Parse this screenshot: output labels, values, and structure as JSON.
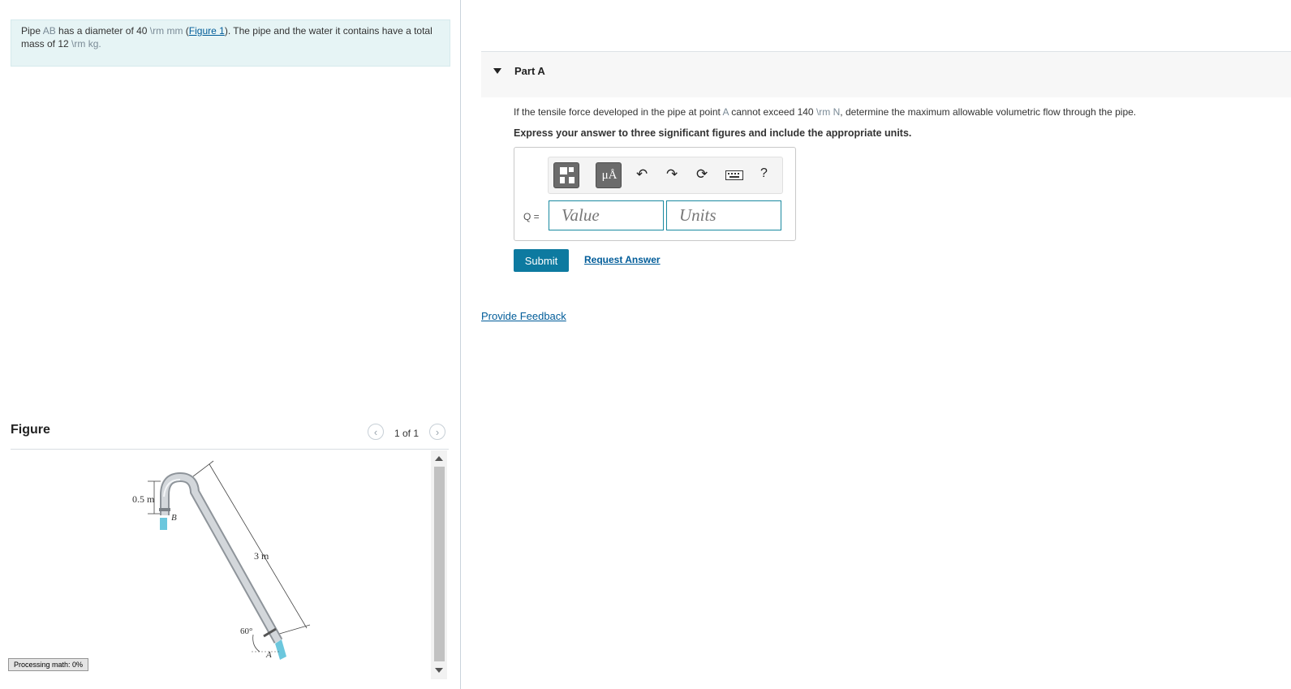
{
  "problem": {
    "pipe_text_1": "Pipe ",
    "pipe_label": "AB",
    "pipe_text_2": " has a diameter of 40 ",
    "diameter_unit": "\\rm mm",
    "paren_open": " (",
    "figure_link": "Figure 1",
    "paren_close": "). The pipe and the water it contains have a total mass of 12 ",
    "mass_unit": "\\rm kg."
  },
  "figure": {
    "heading": "Figure",
    "prev_icon": "chevron-left-icon",
    "next_icon": "chevron-right-icon",
    "page_count": "1 of 1",
    "labels": {
      "height": "0.5 m",
      "length": "3 m",
      "angle": "60°",
      "point_a": "A",
      "point_b": "B"
    },
    "colors": {
      "pipe": "#b9bec3",
      "water": "#6cc7dd"
    }
  },
  "processing": "Processing math: 0%",
  "part": {
    "caret_icon": "caret-down-icon",
    "title": "Part A",
    "question_1": "If the tensile force developed in the pipe at point ",
    "point": "A",
    "question_2": " cannot exceed 140 ",
    "force_unit": "\\rm N",
    "question_3": ", determine the maximum allowable volumetric flow through the pipe.",
    "instruction": "Express your answer to three significant figures and include the appropriate units."
  },
  "toolbar": {
    "template_icon": "template-icon",
    "units_label": "μÅ",
    "undo_icon": "undo-icon",
    "redo_icon": "redo-icon",
    "reset_icon": "reset-icon",
    "keyboard_icon": "keyboard-icon",
    "help_label": "?"
  },
  "answer": {
    "label": "Q =",
    "value_placeholder": "Value",
    "units_placeholder": "Units"
  },
  "actions": {
    "submit": "Submit",
    "request_answer": "Request Answer",
    "feedback": "Provide Feedback"
  },
  "colors": {
    "accent": "#0d7aa0",
    "link": "#005c99",
    "problem_bg": "#e6f4f5"
  }
}
